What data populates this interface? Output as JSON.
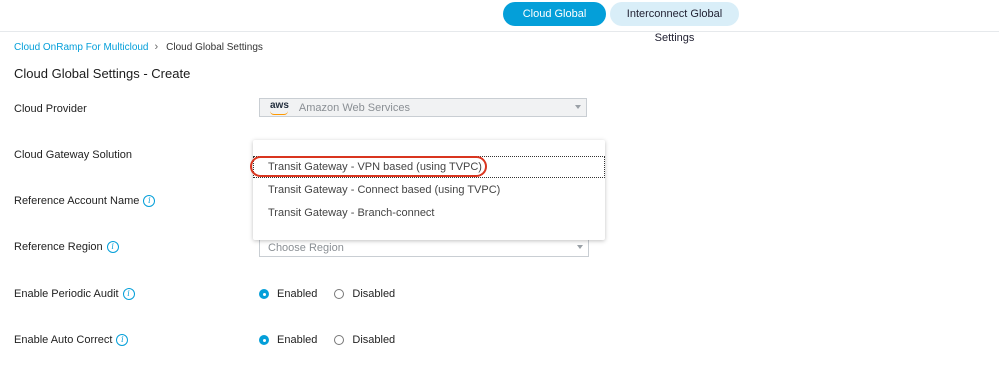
{
  "tabs": [
    {
      "label": "Cloud Global Settings",
      "active": true
    },
    {
      "label": "Interconnect Global Settings",
      "active": false
    }
  ],
  "breadcrumb": {
    "parent": "Cloud OnRamp For Multicloud",
    "current": "Cloud Global Settings"
  },
  "page_title": "Cloud Global Settings - Create",
  "fields": {
    "cloud_provider": {
      "label": "Cloud Provider",
      "logo_text": "aws",
      "value": "Amazon Web Services"
    },
    "cloud_gateway_solution": {
      "label": "Cloud Gateway Solution",
      "options": [
        "Transit Gateway - VPN based (using TVPC)",
        "Transit Gateway - Connect based (using TVPC)",
        "Transit Gateway - Branch-connect"
      ],
      "highlighted_option": "Transit Gateway - VPN based (using TVPC)"
    },
    "reference_account_name": {
      "label": "Reference Account Name"
    },
    "reference_region": {
      "label": "Reference Region",
      "placeholder": "Choose Region"
    },
    "enable_periodic_audit": {
      "label": "Enable Periodic Audit",
      "options": [
        "Enabled",
        "Disabled"
      ],
      "selected": "Enabled"
    },
    "enable_auto_correct": {
      "label": "Enable Auto Correct",
      "options": [
        "Enabled",
        "Disabled"
      ],
      "selected": "Enabled"
    }
  },
  "icons": {
    "info": "info-icon",
    "breadcrumb_separator": "chevron-right-icon",
    "dropdown_caret": "caret-down-icon"
  },
  "colors": {
    "accent": "#049fd9",
    "annotation": "#d9351f",
    "aws_orange": "#ff9900"
  }
}
